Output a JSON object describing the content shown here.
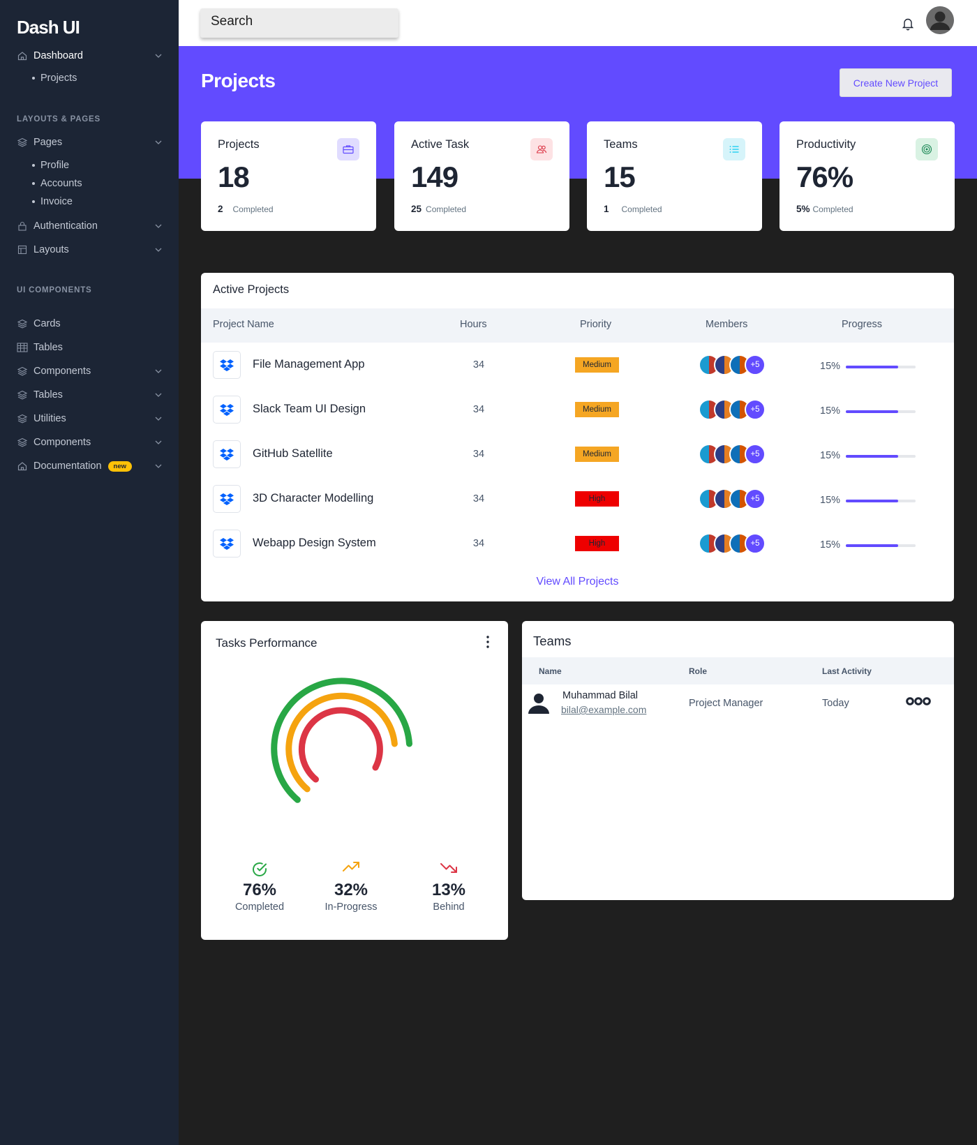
{
  "sidebar": {
    "logo": "Dash UI",
    "dashboard": {
      "label": "Dashboard",
      "icon": "home-icon"
    },
    "dashboard_sub": [
      "Projects"
    ],
    "section_layouts": "LAYOUTS & PAGES",
    "pages": {
      "label": "Pages",
      "icon": "layers-icon"
    },
    "pages_sub": [
      "Profile",
      "Accounts",
      "Invoice"
    ],
    "authentication": {
      "label": "Authentication",
      "icon": "lock-icon"
    },
    "layouts": {
      "label": "Layouts",
      "icon": "layout-icon"
    },
    "section_ui": "UI COMPONENTS",
    "cards": {
      "label": "Cards",
      "icon": "layers-icon"
    },
    "tables1": {
      "label": "Tables",
      "icon": "table-icon"
    },
    "components1": {
      "label": "Components",
      "icon": "layers-icon"
    },
    "tables2": {
      "label": "Tables",
      "icon": "layers-icon"
    },
    "utilities": {
      "label": "Utilities",
      "icon": "layers-icon"
    },
    "components2": {
      "label": "Components",
      "icon": "layers-icon"
    },
    "documentation": {
      "label": "Documentation",
      "badge": "new",
      "icon": "home-icon"
    }
  },
  "topbar": {
    "search_placeholder": "Search",
    "icons": [
      "bell-icon",
      "user-avatar"
    ]
  },
  "header": {
    "title": "Projects",
    "create_button": "Create New Project",
    "accent": "#624bff"
  },
  "stats": [
    {
      "title": "Projects",
      "value": "18",
      "count": "2",
      "foot": "Completed",
      "icon": "briefcase-icon",
      "icon_bg": "#e0dcff",
      "icon_color": "#624bff"
    },
    {
      "title": "Active Task",
      "value": "149",
      "count": "25",
      "foot": "Completed",
      "icon": "people-icon",
      "icon_bg": "#fde2e4",
      "icon_color": "#dc3545"
    },
    {
      "title": "Teams",
      "value": "15",
      "count": "1",
      "foot": "Completed",
      "icon": "list-icon",
      "icon_bg": "#d6f4fa",
      "icon_color": "#0dcaf0"
    },
    {
      "title": "Productivity",
      "value": "76%",
      "count": "5%",
      "foot": "Completed",
      "icon": "target-icon",
      "icon_bg": "#d9f2e3",
      "icon_color": "#198754"
    }
  ],
  "active_projects": {
    "title": "Active Projects",
    "columns": [
      "Project Name",
      "Hours",
      "Priority",
      "Members",
      "Progress"
    ],
    "rows": [
      {
        "name": "File Management App",
        "hours": "34",
        "priority": "Medium",
        "more": "+5",
        "progress": "15%",
        "progress_value": 0.75
      },
      {
        "name": "Slack Team UI Design",
        "hours": "34",
        "priority": "Medium",
        "more": "+5",
        "progress": "15%",
        "progress_value": 0.75
      },
      {
        "name": "GitHub Satellite",
        "hours": "34",
        "priority": "Medium",
        "more": "+5",
        "progress": "15%",
        "progress_value": 0.75
      },
      {
        "name": "3D Character Modelling",
        "hours": "34",
        "priority": "High",
        "more": "+5",
        "progress": "15%",
        "progress_value": 0.75
      },
      {
        "name": "Webapp Design System",
        "hours": "34",
        "priority": "High",
        "more": "+5",
        "progress": "15%",
        "progress_value": 0.75
      }
    ],
    "priority_colors": {
      "Medium": "#f5a623",
      "High": "#ee0000"
    },
    "view_all": "View All Projects"
  },
  "tasks_performance": {
    "title": "Tasks Performance",
    "stats": [
      {
        "value": "76%",
        "label": "Completed",
        "icon": "check-circle-icon",
        "color": "#28a745"
      },
      {
        "value": "32%",
        "label": "In-Progress",
        "icon": "trending-up-icon",
        "color": "#f5a30f"
      },
      {
        "value": "13%",
        "label": "Behind",
        "icon": "trending-down-icon",
        "color": "#dc3545"
      }
    ]
  },
  "teams": {
    "title": "Teams",
    "columns": [
      "Name",
      "Role",
      "Last Activity"
    ],
    "rows": [
      {
        "name": "Muhammad Bilal",
        "email": "bilal@example.com",
        "role": "Project Manager",
        "last_activity": "Today"
      }
    ]
  }
}
